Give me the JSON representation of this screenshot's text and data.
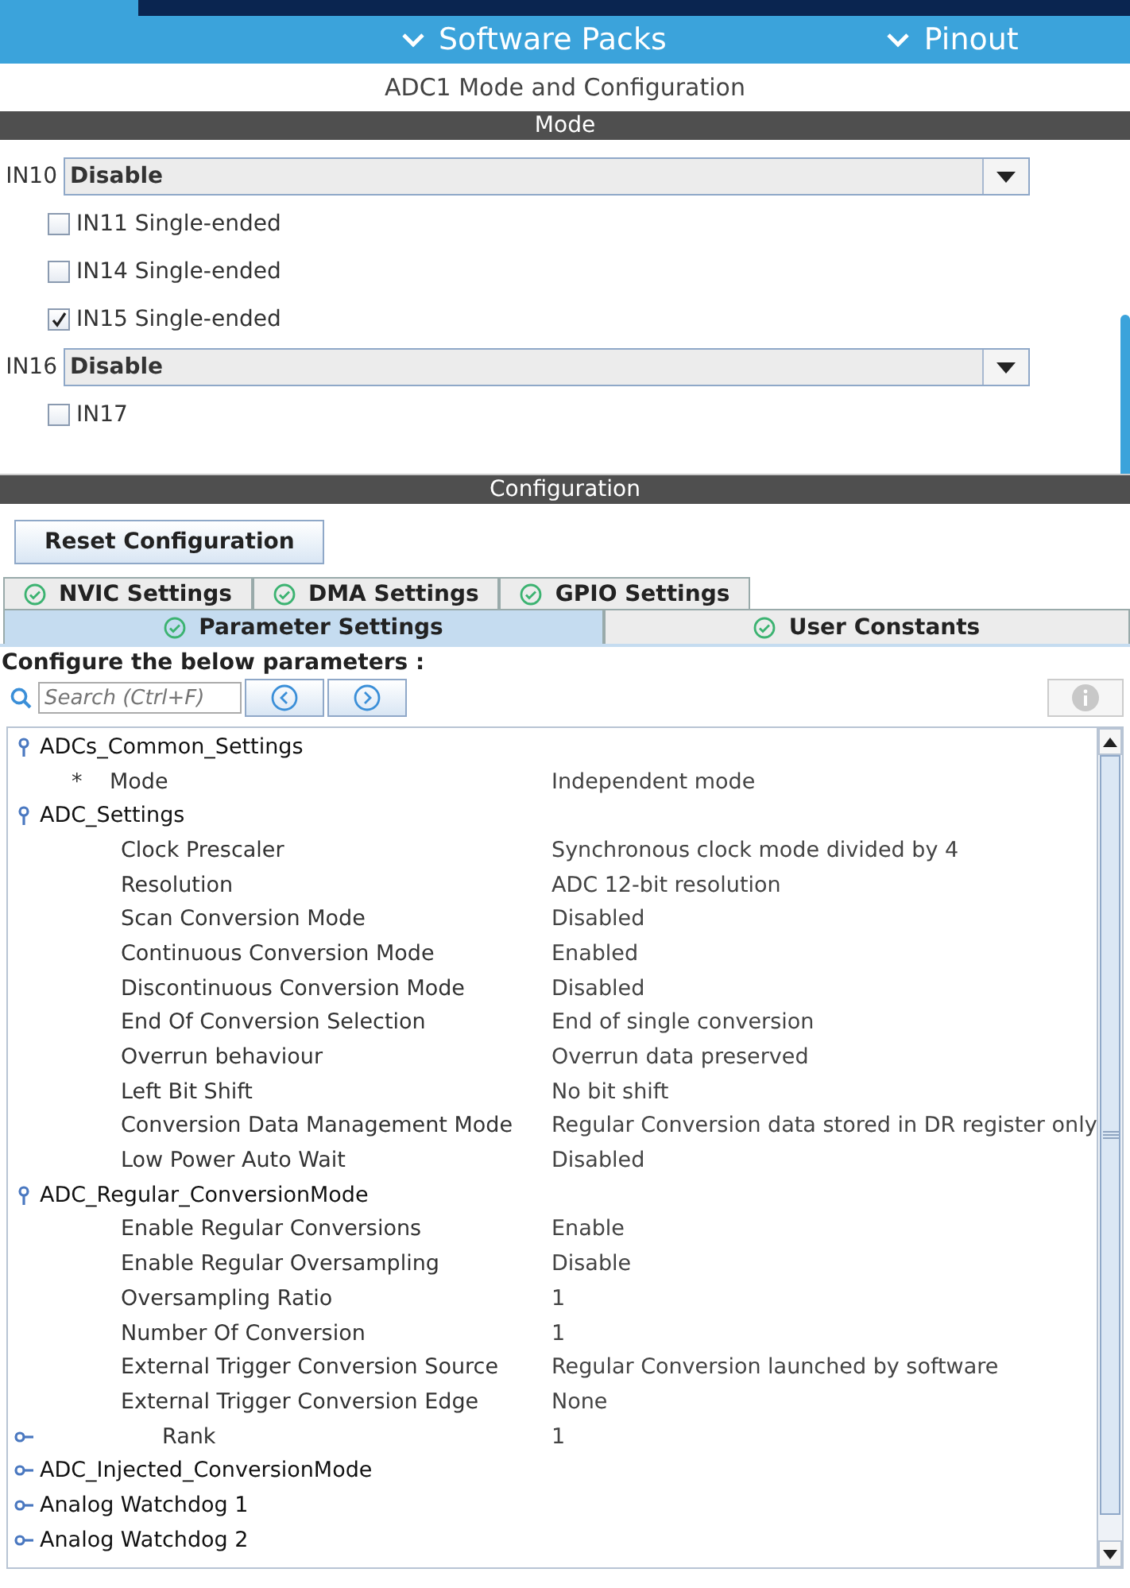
{
  "top_nav": [
    {
      "label": "Software Packs"
    },
    {
      "label": "Pinout"
    }
  ],
  "title": "ADC1 Mode and Configuration",
  "mode": {
    "header": "Mode",
    "items": [
      {
        "kind": "select",
        "label": "IN10",
        "value": "Disable"
      },
      {
        "kind": "checkbox",
        "label": "IN11 Single-ended",
        "checked": false
      },
      {
        "kind": "checkbox",
        "label": "IN14 Single-ended",
        "checked": false
      },
      {
        "kind": "checkbox",
        "label": "IN15 Single-ended",
        "checked": true
      },
      {
        "kind": "select",
        "label": "IN16",
        "value": "Disable"
      },
      {
        "kind": "checkbox",
        "label": "IN17",
        "checked": false
      }
    ]
  },
  "configuration": {
    "header": "Configuration",
    "reset_button": "Reset Configuration",
    "tabs_back": [
      {
        "label": "NVIC Settings",
        "selected": false
      },
      {
        "label": "DMA Settings",
        "selected": false
      },
      {
        "label": "GPIO Settings",
        "selected": false
      }
    ],
    "tabs_front": [
      {
        "label": "Parameter Settings",
        "selected": true
      },
      {
        "label": "User Constants",
        "selected": false
      }
    ],
    "instruction": "Configure the below parameters :",
    "search": {
      "placeholder": "Search (Ctrl+F)"
    },
    "tree": [
      {
        "label": "ADCs_Common_Settings",
        "expanded": true,
        "children": [
          {
            "label": "Mode",
            "value": "Independent mode",
            "marker": "*"
          }
        ]
      },
      {
        "label": "ADC_Settings",
        "expanded": true,
        "children": [
          {
            "label": "Clock Prescaler",
            "value": "Synchronous clock mode divided by 4"
          },
          {
            "label": "Resolution",
            "value": "ADC 12-bit resolution"
          },
          {
            "label": "Scan Conversion Mode",
            "value": "Disabled"
          },
          {
            "label": "Continuous Conversion Mode",
            "value": "Enabled"
          },
          {
            "label": "Discontinuous Conversion Mode",
            "value": "Disabled"
          },
          {
            "label": "End Of Conversion Selection",
            "value": "End of single conversion"
          },
          {
            "label": "Overrun behaviour",
            "value": "Overrun data preserved"
          },
          {
            "label": "Left Bit Shift",
            "value": "No bit shift"
          },
          {
            "label": "Conversion Data Management Mode",
            "value": "Regular Conversion data stored in DR register only"
          },
          {
            "label": "Low Power Auto Wait",
            "value": "Disabled"
          }
        ]
      },
      {
        "label": "ADC_Regular_ConversionMode",
        "expanded": true,
        "children": [
          {
            "label": "Enable Regular Conversions",
            "value": "Enable"
          },
          {
            "label": "Enable Regular Oversampling",
            "value": "Disable"
          },
          {
            "label": "Oversampling Ratio",
            "value": "1"
          },
          {
            "label": "Number Of Conversion",
            "value": "1"
          },
          {
            "label": "External Trigger Conversion Source",
            "value": "Regular Conversion launched by software"
          },
          {
            "label": "External Trigger Conversion Edge",
            "value": "None"
          },
          {
            "label": "Rank",
            "value": "1",
            "expanded": false
          }
        ]
      },
      {
        "label": "ADC_Injected_ConversionMode",
        "expanded": false
      },
      {
        "label": "Analog Watchdog 1",
        "expanded": false
      },
      {
        "label": "Analog Watchdog 2",
        "expanded": false
      }
    ]
  }
}
